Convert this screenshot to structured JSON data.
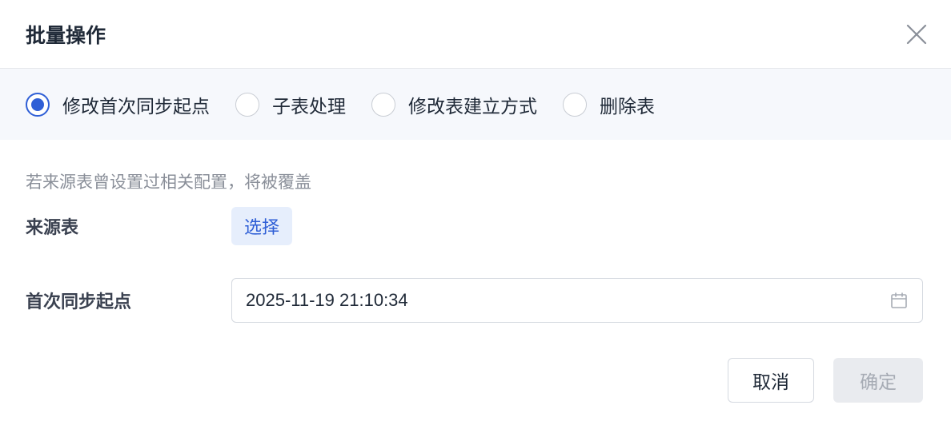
{
  "dialog": {
    "title": "批量操作",
    "close_icon": "close-icon"
  },
  "tabs": {
    "options": [
      {
        "label": "修改首次同步起点",
        "checked": true
      },
      {
        "label": "子表处理",
        "checked": false
      },
      {
        "label": "修改表建立方式",
        "checked": false
      },
      {
        "label": "删除表",
        "checked": false
      }
    ]
  },
  "form": {
    "hint": "若来源表曾设置过相关配置，将被覆盖",
    "source_table": {
      "label": "来源表",
      "button_label": "选择"
    },
    "start_point": {
      "label": "首次同步起点",
      "value": "2025-11-19 21:10:34",
      "icon": "calendar-icon"
    }
  },
  "footer": {
    "cancel_label": "取消",
    "confirm_label": "确定"
  },
  "colors": {
    "accent": "#2f5fd6",
    "tab_bg": "#f6f8fc",
    "select_bg": "#e6eefc",
    "disabled_bg": "#e9ebef"
  }
}
